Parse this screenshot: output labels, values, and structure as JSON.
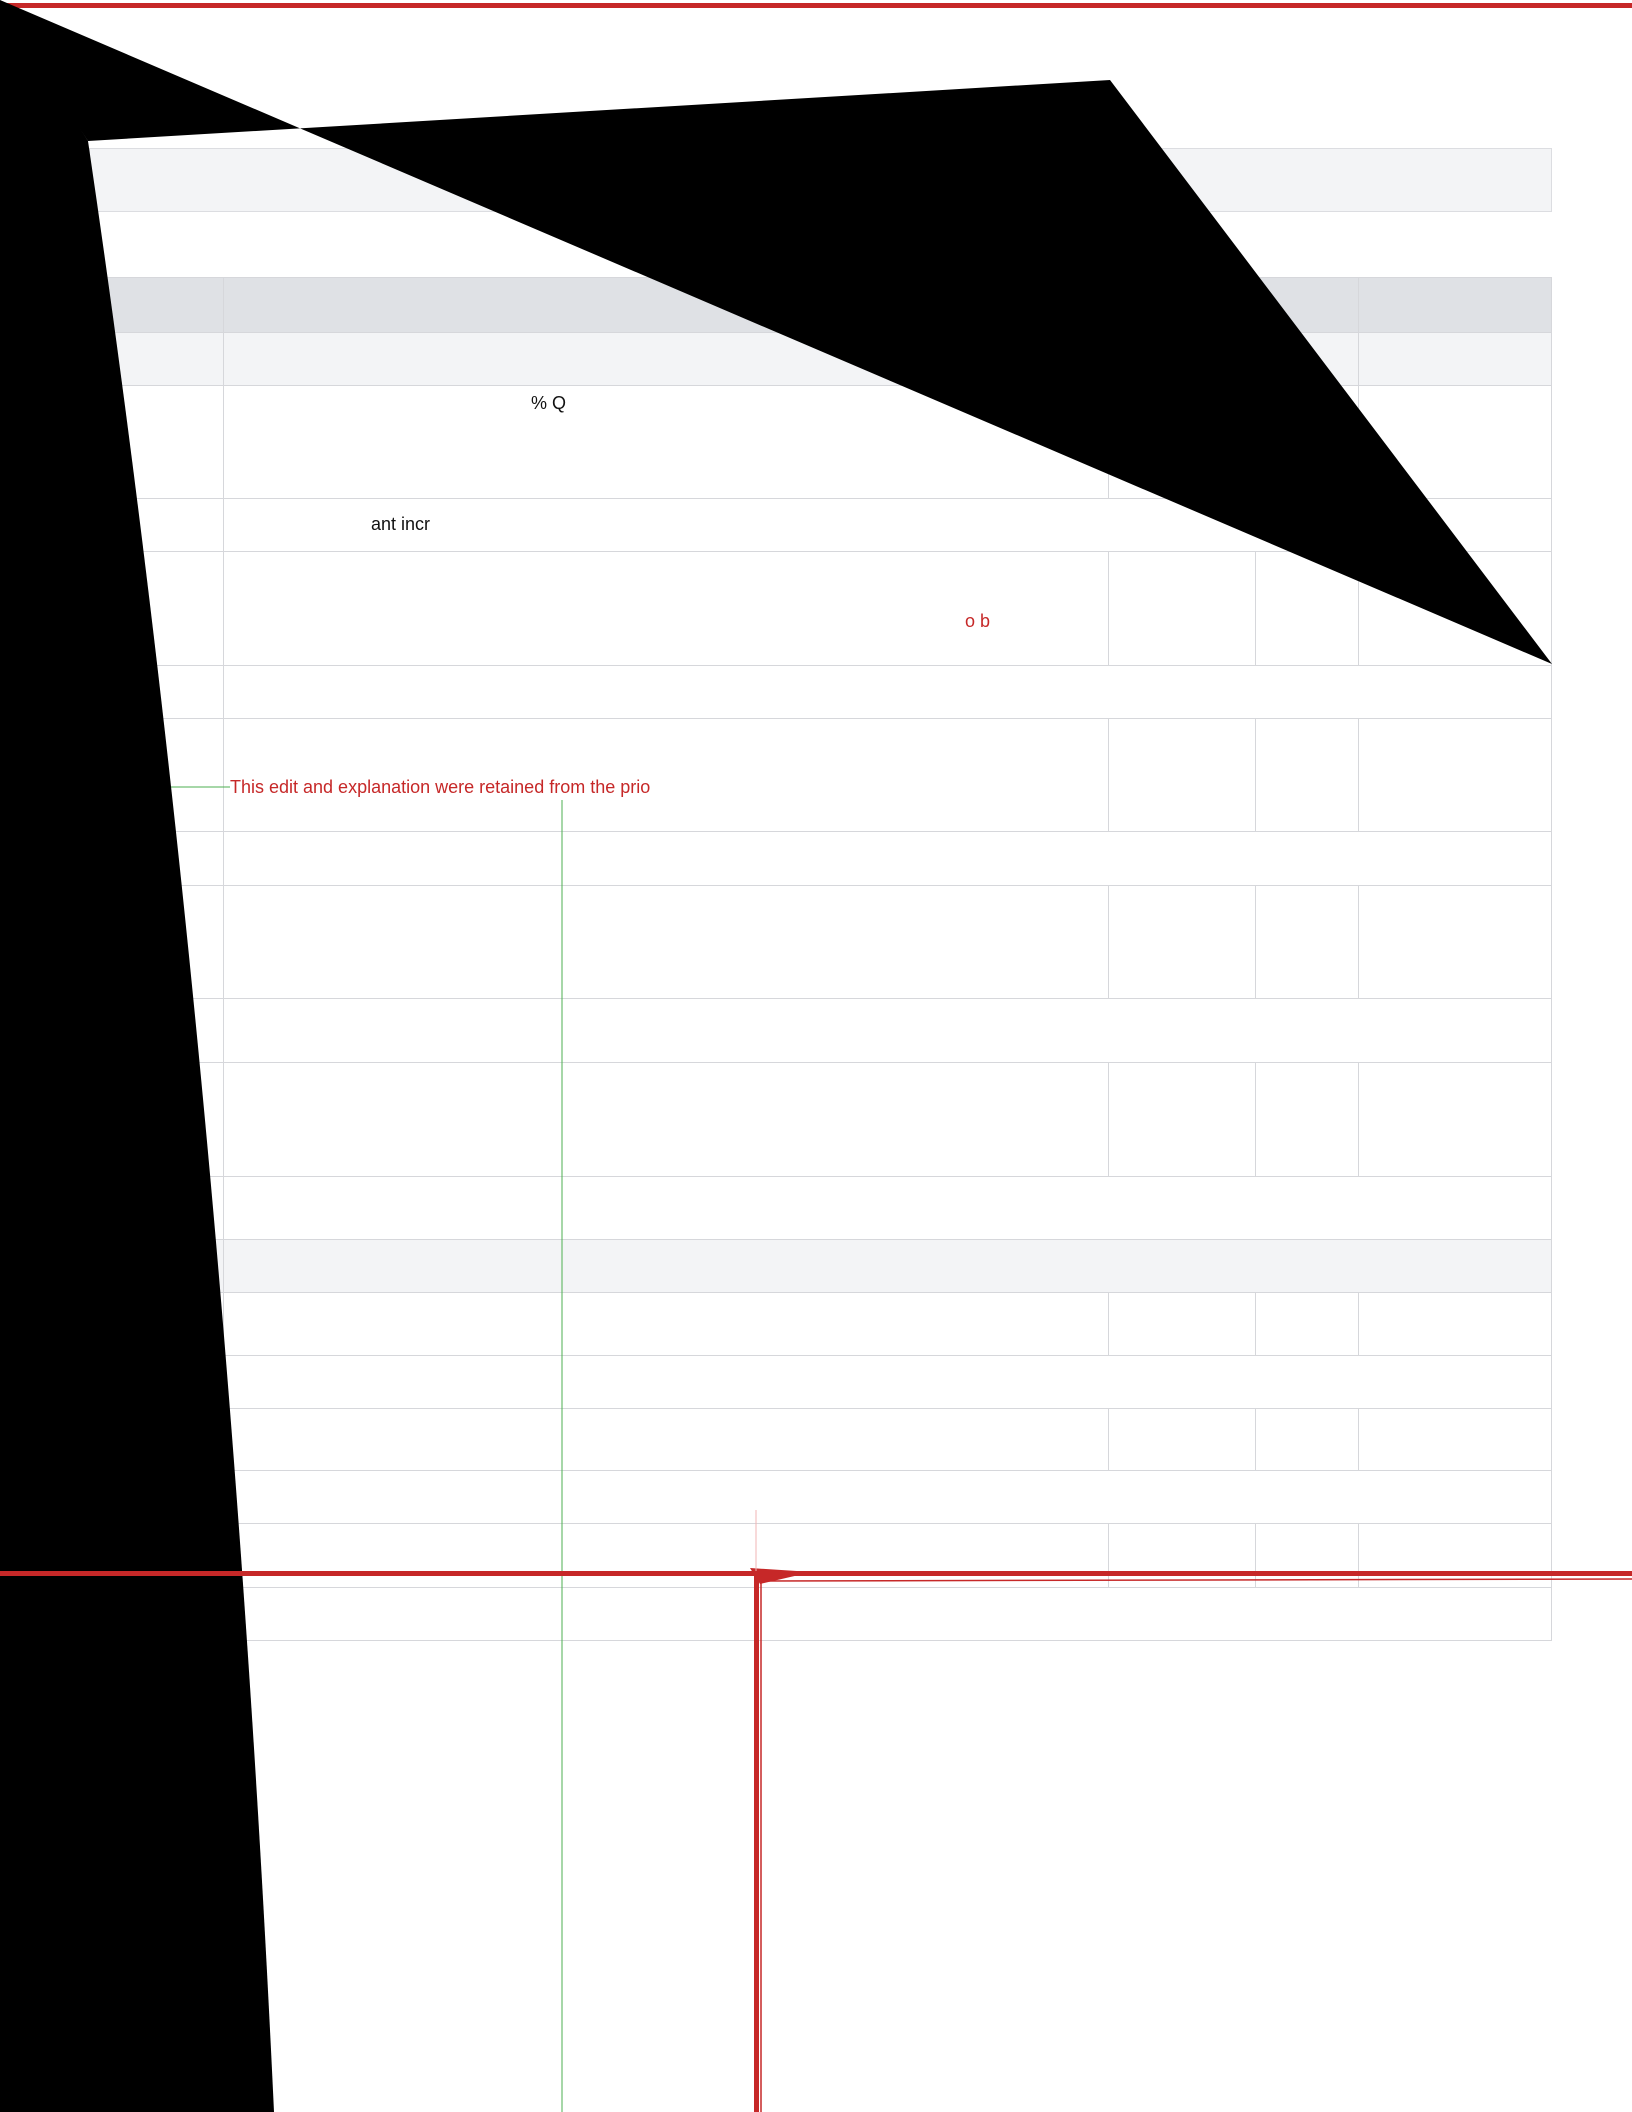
{
  "document": {
    "cells": [
      {
        "id": "cell-a",
        "text": "% Q"
      },
      {
        "id": "cell-b",
        "text": "ant incr"
      },
      {
        "id": "cell-c",
        "text": "o b"
      },
      {
        "id": "cell-d",
        "text": "This edit and explanation were retained from the prio"
      }
    ]
  },
  "colors": {
    "accent_red": "#c62828",
    "guide_green": "#4caf50",
    "header_gray": "#dfe1e5",
    "group_gray": "#f3f4f6",
    "border_gray": "#d6d7db"
  }
}
